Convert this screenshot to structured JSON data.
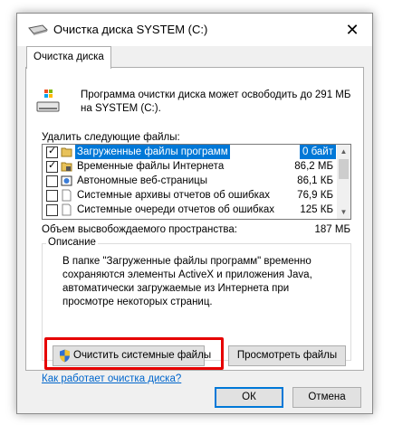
{
  "window": {
    "title": "Очистка диска SYSTEM (C:)",
    "close_symbol": "✕",
    "tab_label": "Очистка диска"
  },
  "intro_text": "Программа очистки диска может освободить до 291 МБ на SYSTEM (C:).",
  "files_section_label": "Удалить следующие файлы:",
  "file_list": [
    {
      "checked": true,
      "icon": "folder-icon",
      "name": "Загруженные файлы программ",
      "size": "0 байт",
      "selected": true
    },
    {
      "checked": true,
      "icon": "lock-folder-icon",
      "name": "Временные файлы Интернета",
      "size": "86,2 МБ",
      "selected": false
    },
    {
      "checked": false,
      "icon": "offline-page-icon",
      "name": "Автономные веб-страницы",
      "size": "86,1 КБ",
      "selected": false
    },
    {
      "checked": false,
      "icon": "document-icon",
      "name": "Системные архивы отчетов об ошибках",
      "size": "76,9 КБ",
      "selected": false
    },
    {
      "checked": false,
      "icon": "document-icon",
      "name": "Системные очереди отчетов об ошибках",
      "size": "125 КБ",
      "selected": false
    }
  ],
  "scrollbar": {
    "up": "▲",
    "down": "▼"
  },
  "space": {
    "label": "Объем высвобождаемого пространства:",
    "value": "187 МБ"
  },
  "description": {
    "title": "Описание",
    "text": "В папке \"Загруженные файлы программ\" временно сохраняются элементы ActiveX и приложения Java, автоматически загружаемые из Интернета при просмотре некоторых страниц."
  },
  "buttons": {
    "clean_system": "Очистить системные файлы",
    "view_files": "Просмотреть файлы",
    "ok": "ОК",
    "cancel": "Отмена"
  },
  "help_link": "Как работает очистка диска?",
  "colors": {
    "selection": "#0078d7",
    "highlight": "#e60000",
    "link": "#0066cc"
  }
}
